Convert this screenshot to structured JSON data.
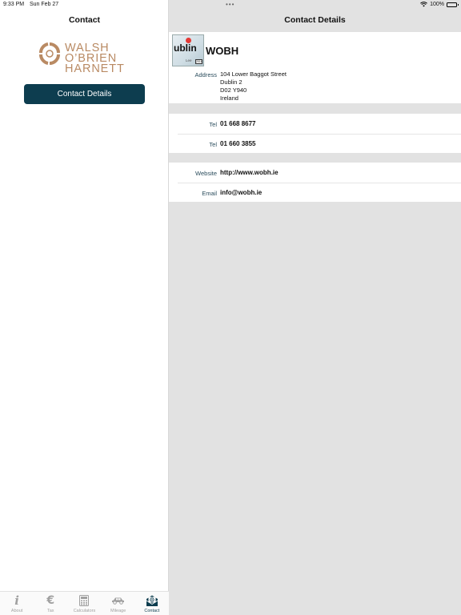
{
  "status": {
    "time": "9:33 PM",
    "date": "Sun Feb 27",
    "dots": "•••",
    "battery": "100%"
  },
  "master": {
    "title": "Contact",
    "logo": {
      "line1": "WALSH",
      "line2": "O’BRIEN",
      "line3": "HARNETT"
    },
    "contact_button": "Contact Details"
  },
  "tabs": [
    {
      "label": "About",
      "icon": "info-icon"
    },
    {
      "label": "Tax",
      "icon": "euro-icon"
    },
    {
      "label": "Calculators",
      "icon": "calculator-icon"
    },
    {
      "label": "Mileage",
      "icon": "car-icon"
    },
    {
      "label": "Contact",
      "icon": "contact-envelope-icon",
      "active": true
    }
  ],
  "detail": {
    "title": "Contact Details",
    "header": {
      "name": "WOBH",
      "thumb_text": "ublin",
      "thumb_small": "Lee",
      "thumb_badge": "2018"
    },
    "address": {
      "label": "Address",
      "lines": [
        "104 Lower Baggot Street",
        "Dublin 2",
        "D02 Y940",
        "Ireland"
      ]
    },
    "phones": [
      {
        "label": "Tel",
        "value": "01 668 8677"
      },
      {
        "label": "Tel",
        "value": "01 660 3855"
      }
    ],
    "website": {
      "label": "Website",
      "value": "http://www.wobh.ie"
    },
    "email": {
      "label": "Email",
      "value": "info@wobh.ie"
    }
  },
  "colors": {
    "accent": "#0d3d4f",
    "logo": "#b98a63",
    "background_detail": "#e2e2e2",
    "label": "#2a4c5c"
  }
}
